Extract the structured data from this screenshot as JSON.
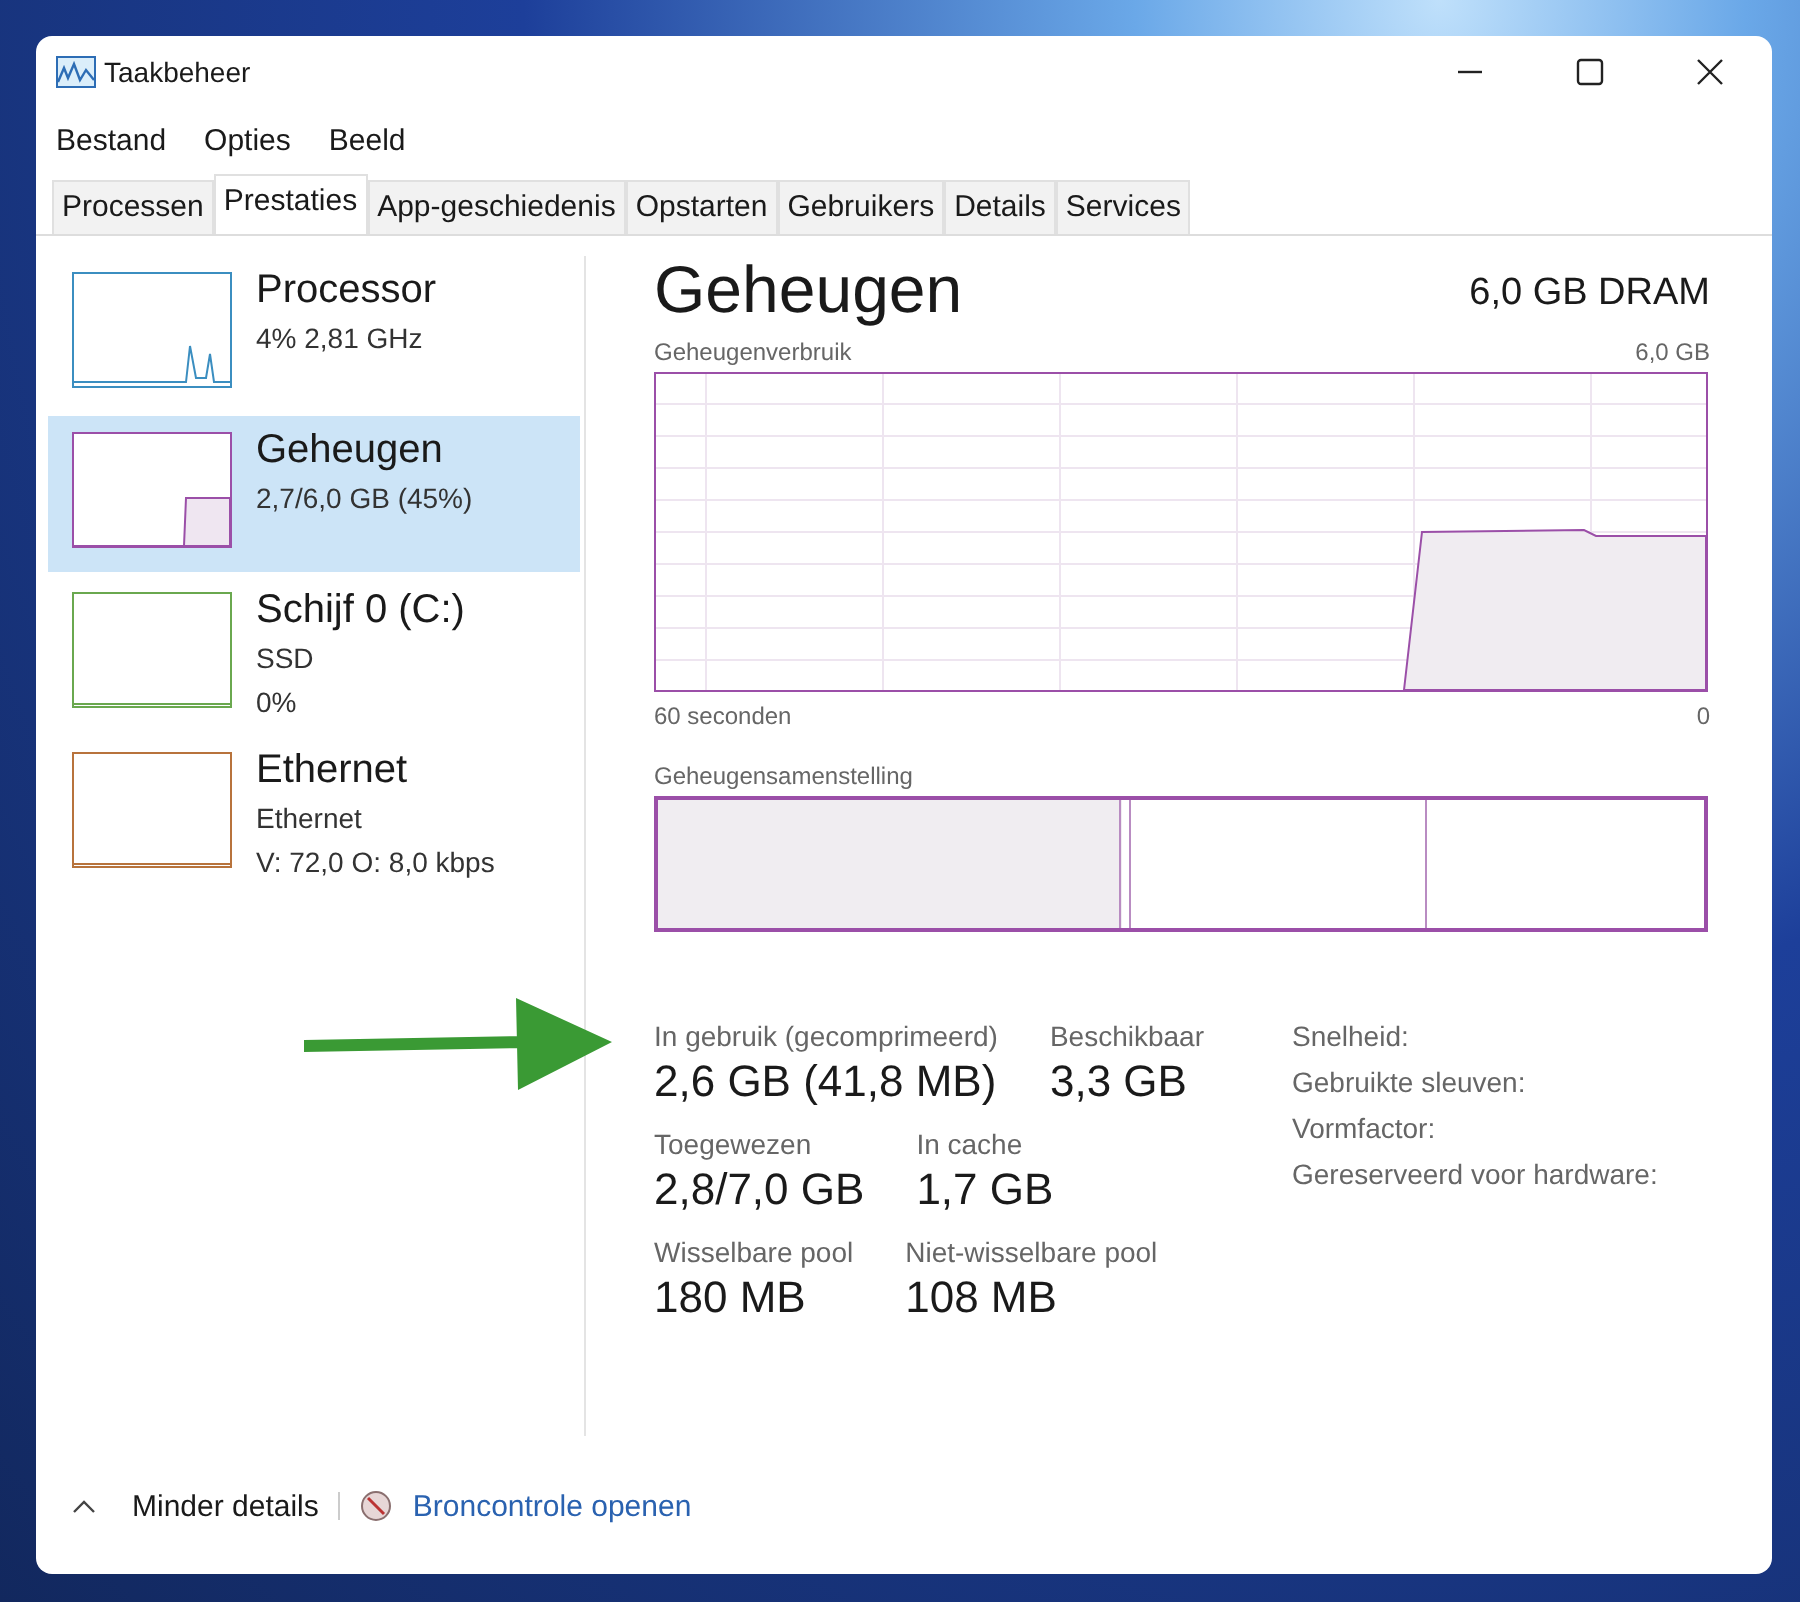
{
  "window": {
    "title": "Taakbeheer"
  },
  "menu": [
    "Bestand",
    "Opties",
    "Beeld"
  ],
  "tabs": [
    {
      "label": "Processen",
      "selected": false
    },
    {
      "label": "Prestaties",
      "selected": true
    },
    {
      "label": "App-geschiedenis",
      "selected": false
    },
    {
      "label": "Opstarten",
      "selected": false
    },
    {
      "label": "Gebruikers",
      "selected": false
    },
    {
      "label": "Details",
      "selected": false
    },
    {
      "label": "Services",
      "selected": false
    }
  ],
  "sidebar": {
    "items": [
      {
        "kind": "processor",
        "name": "Processor",
        "lines": [
          "4%  2,81 GHz"
        ],
        "color": "#3b8ec0",
        "selected": false
      },
      {
        "kind": "memory",
        "name": "Geheugen",
        "lines": [
          "2,7/6,0 GB (45%)"
        ],
        "color": "#9b4fa8",
        "selected": true
      },
      {
        "kind": "disk",
        "name": "Schijf 0 (C:)",
        "lines": [
          "SSD",
          "0%"
        ],
        "color": "#6aa84f",
        "selected": false
      },
      {
        "kind": "network",
        "name": "Ethernet",
        "lines": [
          "Ethernet",
          "V: 72,0  O: 8,0 kbps"
        ],
        "color": "#b8733c",
        "selected": false
      }
    ]
  },
  "panel": {
    "title": "Geheugen",
    "subtitle": "6,0 GB DRAM",
    "usage_graph": {
      "label": "Geheugenverbruik",
      "max": "6,0 GB",
      "x_start": "60 seconden",
      "x_end": "0"
    },
    "composition": {
      "label": "Geheugensamenstelling"
    },
    "stats": [
      [
        {
          "label": "In gebruik (gecomprimeerd)",
          "value": "2,6 GB (41,8 MB)"
        },
        {
          "label": "Beschikbaar",
          "value": "3,3 GB"
        }
      ],
      [
        {
          "label": "Toegewezen",
          "value": "2,8/7,0 GB"
        },
        {
          "label": "In cache",
          "value": "1,7 GB"
        }
      ],
      [
        {
          "label": "Wisselbare pool",
          "value": "180 MB"
        },
        {
          "label": "Niet-wisselbare pool",
          "value": "108 MB"
        }
      ]
    ],
    "details": [
      "Snelheid:",
      "Gebruikte sleuven:",
      "Vormfactor:",
      "Gereserveerd voor hardware:"
    ]
  },
  "footer": {
    "toggle": "Minder details",
    "link": "Broncontrole openen"
  }
}
